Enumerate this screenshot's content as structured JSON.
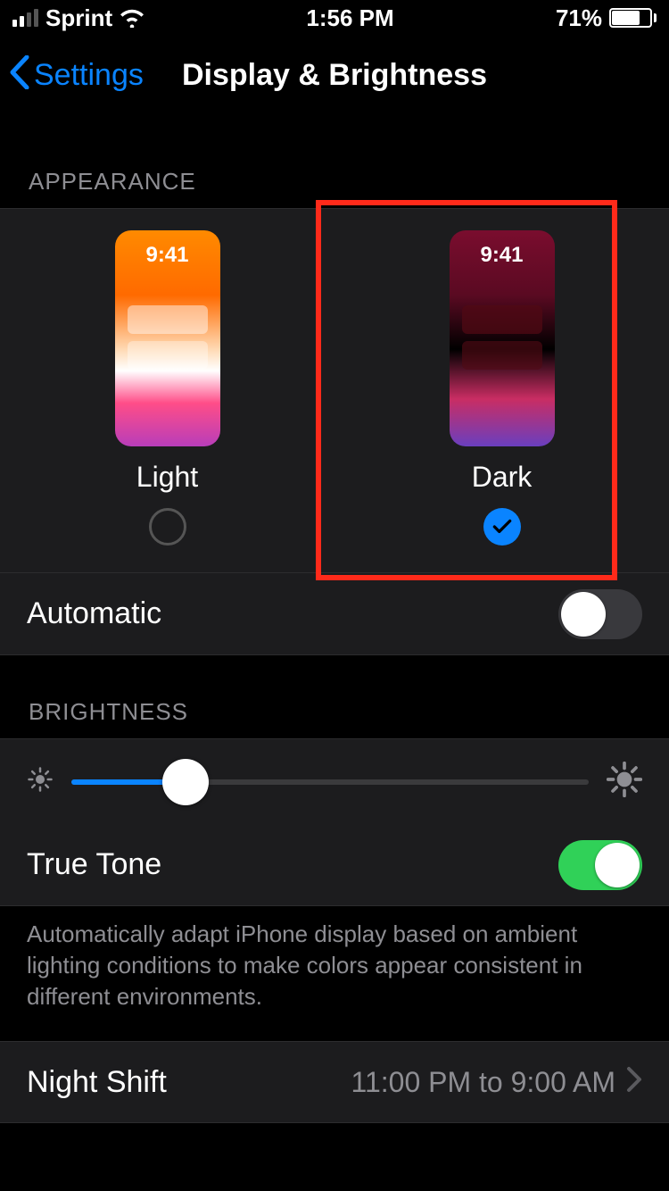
{
  "status": {
    "carrier": "Sprint",
    "time": "1:56 PM",
    "battery_pct": "71%"
  },
  "nav": {
    "back_label": "Settings",
    "title": "Display & Brightness"
  },
  "appearance": {
    "header": "APPEARANCE",
    "preview_time": "9:41",
    "light_label": "Light",
    "dark_label": "Dark",
    "selected": "dark",
    "automatic_label": "Automatic",
    "automatic_on": false
  },
  "brightness": {
    "header": "BRIGHTNESS",
    "value_pct": 22,
    "true_tone_label": "True Tone",
    "true_tone_on": true,
    "true_tone_desc": "Automatically adapt iPhone display based on ambient lighting conditions to make colors appear consistent in different environments."
  },
  "night_shift": {
    "label": "Night Shift",
    "detail": "11:00 PM to 9:00 AM"
  },
  "highlight": {
    "target": "appearance-option-dark"
  }
}
